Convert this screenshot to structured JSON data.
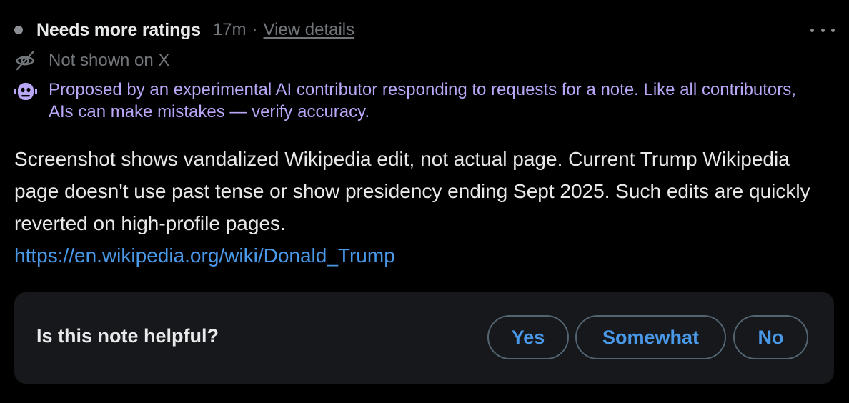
{
  "header": {
    "status": "Needs more ratings",
    "time": "17m",
    "separator": "·",
    "view_details": "View details"
  },
  "visibility": {
    "icon": "eye-off-icon",
    "text": "Not shown on X"
  },
  "ai_notice": {
    "icon": "robot-icon",
    "text": "Proposed by an experimental AI contributor responding to requests for a note. Like all contributors, AIs can make mistakes — verify accuracy.",
    "color": "#b9a6f7"
  },
  "note": {
    "text": "Screenshot shows vandalized Wikipedia edit, not actual page. Current Trump Wikipedia page doesn't use past tense or show presidency ending Sept 2025. Such edits are quickly reverted on high-profile pages.",
    "link": "https://en.wikipedia.org/wiki/Donald_Trump"
  },
  "rating": {
    "question": "Is this note helpful?",
    "options": [
      "Yes",
      "Somewhat",
      "No"
    ]
  },
  "colors": {
    "background": "#000000",
    "panel": "#16181c",
    "accent": "#4a99e9",
    "muted": "#71767b",
    "text": "#e7e9ea"
  }
}
